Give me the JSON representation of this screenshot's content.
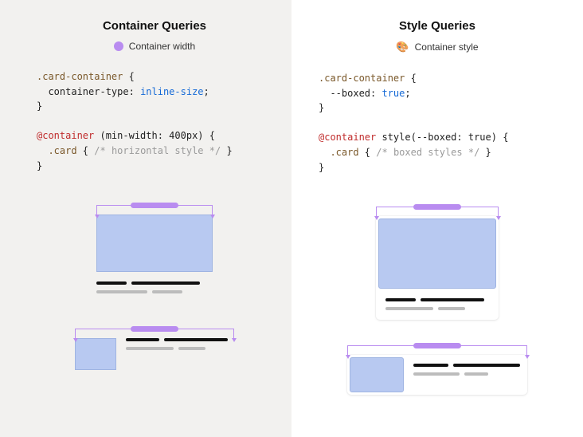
{
  "left": {
    "heading": "Container Queries",
    "legend": "Container width",
    "code": {
      "selector": ".card-container",
      "prop": "container-type",
      "value": "inline-size",
      "at_rule": "@container",
      "condition": "(min-width: 400px)",
      "child_selector": ".card",
      "comment": "/* horizontal style */"
    }
  },
  "right": {
    "heading": "Style Queries",
    "legend": "Container style",
    "code": {
      "selector": ".card-container",
      "prop": "--boxed",
      "value": "true",
      "at_rule": "@container",
      "condition": "style(--boxed: true)",
      "child_selector": ".card",
      "comment": "/* boxed styles */"
    }
  },
  "colors": {
    "accent_purple": "#b98cf0",
    "image_fill": "#b8c9f1"
  }
}
